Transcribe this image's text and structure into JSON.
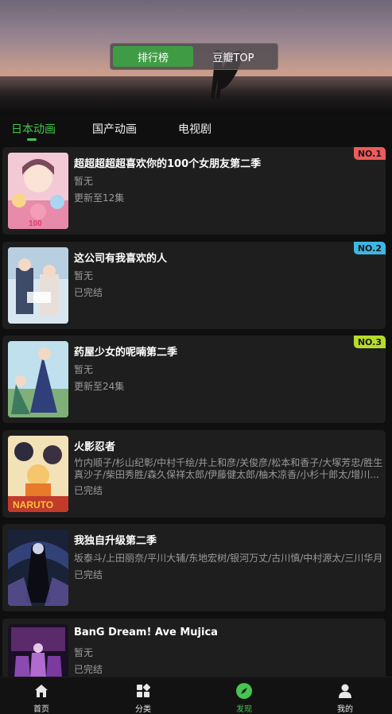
{
  "segment": {
    "options": [
      "排行榜",
      "豆瓣TOP"
    ],
    "selected": "排行榜"
  },
  "tabs": [
    {
      "label": "日本动画",
      "active": true
    },
    {
      "label": "国产动画",
      "active": false
    },
    {
      "label": "电视剧",
      "active": false
    }
  ],
  "items": [
    {
      "title": "超超超超超喜欢你的100个女朋友第二季",
      "line1": "暂无",
      "line2": "更新至12集",
      "rank": "NO.1",
      "rank_color": "#ef5a5a"
    },
    {
      "title": "这公司有我喜欢的人",
      "line1": "暂无",
      "line2": "已完结",
      "rank": "NO.2",
      "rank_color": "#3fb6e3"
    },
    {
      "title": "药屋少女的呢喃第二季",
      "line1": "暂无",
      "line2": "更新至24集",
      "rank": "NO.3",
      "rank_color": "#b6dc2b"
    },
    {
      "title": "火影忍者",
      "line1": "竹内顺子/杉山纪彰/中村千绘/井上和彦/关俊彦/松本和香子/大塚芳忠/胜生",
      "line1b": "真沙子/柴田秀胜/森久保祥太郎/伊藤健太郎/柚木凉香/小杉十郎太/增川...",
      "line2": "已完结",
      "rank": "",
      "rank_color": ""
    },
    {
      "title": "我独自升级第二季",
      "line1": "坂泰斗/上田丽奈/平川大辅/东地宏树/银河万丈/古川慎/中村源太/三川华月",
      "line2": "已完结",
      "rank": "",
      "rank_color": ""
    },
    {
      "title": "BanG Dream! Ave Mujica",
      "line1": "暂无",
      "line2": "已完结",
      "rank": "",
      "rank_color": ""
    }
  ],
  "nav": [
    {
      "label": "首页",
      "icon": "home-icon"
    },
    {
      "label": "分类",
      "icon": "grid-icon"
    },
    {
      "label": "发现",
      "icon": "compass-icon",
      "active": true
    },
    {
      "label": "我的",
      "icon": "user-icon"
    }
  ],
  "colors": {
    "accent": "#46c54f",
    "card_bg": "#1e1e1e",
    "page_bg": "#0f0f0f"
  }
}
